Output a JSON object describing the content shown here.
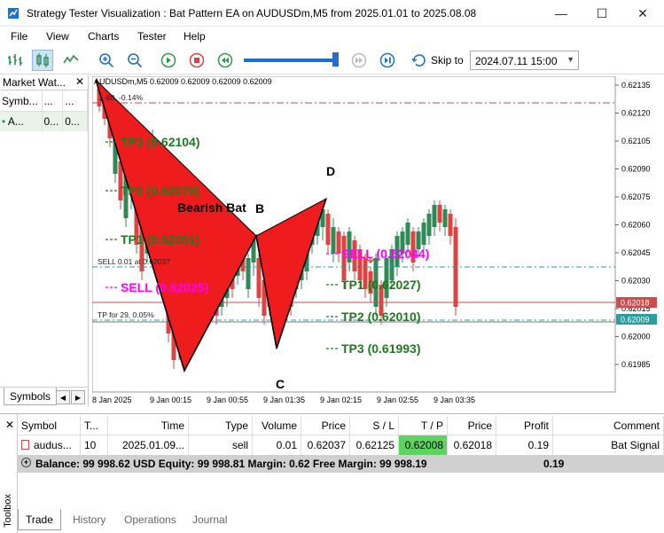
{
  "window": {
    "title": "Strategy Tester Visualization : Bat Pattern EA on AUDUSDm,M5 from 2025.01.01 to 2025.08.08",
    "minimize": "—",
    "maximize": "☐",
    "close": "✕"
  },
  "menu": [
    "File",
    "View",
    "Charts",
    "Tester",
    "Help"
  ],
  "toolbar": {
    "skip_label": "Skip to",
    "skip_date": "2024.07.11 15:00",
    "speed": 0.95
  },
  "market_watch": {
    "title": "Market Wat...",
    "columns": [
      "Symb...",
      "...",
      "..."
    ],
    "row": [
      "A...",
      "0...",
      "0..."
    ],
    "tab": "Symbols"
  },
  "chart": {
    "symbol_header": "AUDUSDm,M5  0.62009 0.62009 0.62009 0.62009",
    "line_label_a": "...-88, -0.14%",
    "sell_level_label": "SELL 0.01 at 0.62037",
    "tp_level_label": "TP for 29, 0.05%",
    "price_axis": [
      "0.62135",
      "0.62120",
      "0.62105",
      "0.62090",
      "0.62075",
      "0.62060",
      "0.62045",
      "0.62030",
      "0.62015",
      "0.62000",
      "0.61985"
    ],
    "time_axis": [
      "8 Jan 2025",
      "9 Jan 00:15",
      "9 Jan 00:55",
      "9 Jan 01:35",
      "9 Jan 02:15",
      "9 Jan 02:55",
      "9 Jan 03:35"
    ],
    "current_price_red": "0.62018",
    "current_price_green": "0.62009",
    "pattern_label": "Bearish Bat",
    "point_b": "B",
    "point_c": "C",
    "point_d": "D",
    "left_tp3": "TP3 (0.62104)",
    "left_tp2": "TP2 (0.62078)",
    "left_tp1": "TP1 (0.62051)",
    "left_sell": "SELL (0.62025)",
    "right_sell": "SELL (0.62044)",
    "right_tp1": "TP1 (0.62027)",
    "right_tp2": "TP2 (0.62010)",
    "right_tp3": "TP3 (0.61993)",
    "colors": {
      "pattern_fill": "#ee1c1c",
      "bull": "#2e8b57",
      "bear": "#e0433f",
      "tp_text": "#1f7a1f",
      "sell_text": "#ff00ff",
      "level_red": "#d14b4b",
      "level_teal": "#2a9d9d"
    }
  },
  "trade": {
    "columns": [
      "Symbol",
      "T...",
      "Time",
      "Type",
      "Volume",
      "Price",
      "S / L",
      "T / P",
      "Price",
      "Profit",
      "Comment"
    ],
    "row": [
      "audus...",
      "10",
      "2025.01.09...",
      "sell",
      "0.01",
      "0.62037",
      "0.62125",
      "0.62008",
      "0.62018",
      "0.19",
      "Bat Signal"
    ],
    "balance_text": "Balance: 99 998.62 USD  Equity: 99 998.81  Margin: 0.62  Free Margin: 99 998.19",
    "balance_profit": "0.19",
    "toolbox_label": "Toolbox",
    "tabs": [
      "Trade",
      "History",
      "Operations",
      "Journal"
    ]
  }
}
